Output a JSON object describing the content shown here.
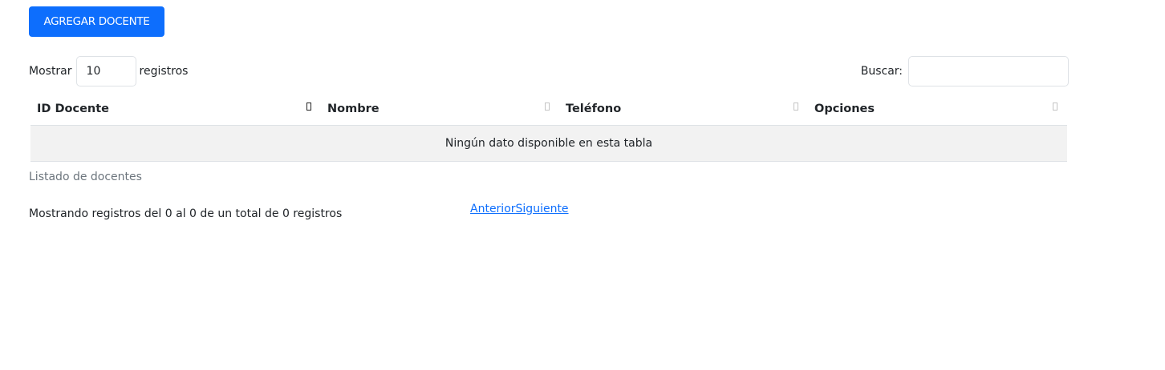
{
  "toolbar": {
    "add_label": "AGREGAR DOCENTE"
  },
  "length": {
    "prefix": "Mostrar",
    "value": "10",
    "suffix": "registros"
  },
  "search": {
    "label": "Buscar:",
    "value": "",
    "placeholder": ""
  },
  "table": {
    "headers": [
      "ID Docente",
      "Nombre",
      "Teléfono",
      "Opciones"
    ],
    "empty_message": "Ningún dato disponible en esta tabla",
    "caption": "Listado de docentes"
  },
  "info": "Mostrando registros del 0 al 0 de un total de 0 registros",
  "pagination": {
    "previous": "Anterior",
    "next": "Siguiente"
  },
  "colors": {
    "primary": "#0d6efd",
    "empty_row_bg": "#f2f2f2",
    "border": "#dee2e6"
  }
}
